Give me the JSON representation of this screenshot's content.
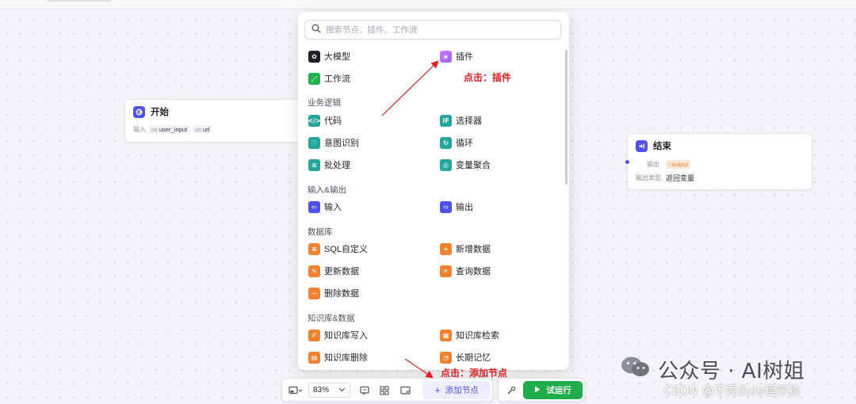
{
  "canvas": {
    "start_node": {
      "title": "开始",
      "input_label": "输入",
      "params": [
        {
          "type": "str.",
          "name": "user_input"
        },
        {
          "type": "str.",
          "name": "url"
        }
      ]
    },
    "end_node": {
      "title": "结束",
      "output_label": "输出",
      "output_value": "output",
      "output_type_label": "输出类型",
      "output_type_value": "返回变量"
    }
  },
  "node_panel": {
    "search_placeholder": "搜索节点、插件、工作流",
    "top_items": {
      "llm": "大模型",
      "plugin": "插件",
      "workflow": "工作流"
    },
    "sections": {
      "business_logic": {
        "title": "业务逻辑",
        "items": [
          "代码",
          "选择器",
          "意图识别",
          "循环",
          "批处理",
          "变量聚合"
        ]
      },
      "io": {
        "title": "输入&输出",
        "items": [
          "输入",
          "输出"
        ]
      },
      "database": {
        "title": "数据库",
        "items": [
          "SQL自定义",
          "新增数据",
          "更新数据",
          "查询数据",
          "删除数据"
        ]
      },
      "knowledge": {
        "title": "知识库&数据",
        "items": [
          "知识库写入",
          "知识库检索",
          "知识库删除",
          "长期记忆"
        ]
      }
    }
  },
  "annotations": {
    "plugin_hint": "点击：插件",
    "add_node_hint": "点击：添加节点"
  },
  "toolbar": {
    "zoom_value": "83%",
    "add_node_label": "添加节点",
    "run_label": "试运行"
  },
  "watermark": {
    "main": "公众号 · AI树姐",
    "sub": "CSDN @不秃头de程序猿"
  },
  "colors": {
    "accent": "#4d53e8",
    "run_green": "#1fad4b",
    "annotation_red": "#e02020",
    "icon_purple": "#b668f0",
    "icon_green": "#1fb24a",
    "icon_teal": "#25a59b",
    "icon_orange": "#f08230"
  }
}
